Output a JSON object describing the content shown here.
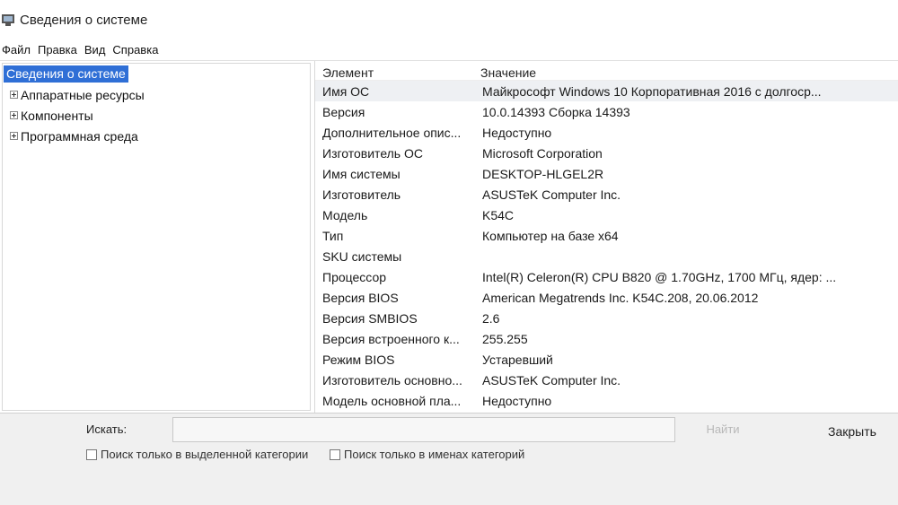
{
  "window": {
    "title": "Сведения о системе"
  },
  "menu": [
    "Файл",
    "Правка",
    "Вид",
    "Справка"
  ],
  "tree": {
    "root": "Сведения о системе",
    "children": [
      "Аппаратные ресурсы",
      "Компоненты",
      "Программная среда"
    ]
  },
  "table": {
    "headers": {
      "element": "Элемент",
      "value": "Значение"
    },
    "rows": [
      {
        "element": "Имя ОС",
        "value": "Майкрософт Windows 10 Корпоративная 2016 с долгоср..."
      },
      {
        "element": "Версия",
        "value": "10.0.14393 Сборка 14393"
      },
      {
        "element": "Дополнительное опис...",
        "value": "Недоступно"
      },
      {
        "element": "Изготовитель ОС",
        "value": "Microsoft Corporation"
      },
      {
        "element": "Имя системы",
        "value": "DESKTOP-HLGEL2R"
      },
      {
        "element": "Изготовитель",
        "value": "ASUSTeK Computer Inc."
      },
      {
        "element": "Модель",
        "value": "K54C"
      },
      {
        "element": "Тип",
        "value": "Компьютер на базе x64"
      },
      {
        "element": "SKU системы",
        "value": ""
      },
      {
        "element": "Процессор",
        "value": "Intel(R) Celeron(R) CPU B820 @ 1.70GHz, 1700 МГц, ядер: ..."
      },
      {
        "element": "Версия BIOS",
        "value": "American Megatrends Inc. K54C.208, 20.06.2012"
      },
      {
        "element": "Версия SMBIOS",
        "value": "2.6"
      },
      {
        "element": "Версия встроенного к...",
        "value": "255.255"
      },
      {
        "element": "Режим BIOS",
        "value": "Устаревший"
      },
      {
        "element": "Изготовитель основно...",
        "value": "ASUSTeK Computer Inc."
      },
      {
        "element": "Модель основной пла...",
        "value": "Недоступно"
      }
    ]
  },
  "search": {
    "label": "Искать:",
    "value": "",
    "find_button": "Найти",
    "close_button": "Закрыть",
    "checkbox_selected_category": "Поиск только в выделенной категории",
    "checkbox_category_names": "Поиск только в именах категорий"
  }
}
